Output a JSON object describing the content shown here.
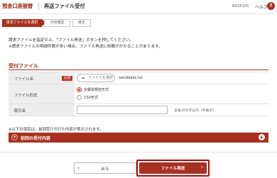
{
  "header": {
    "app_title": "預金口座振替",
    "page_title": "再送ファイル受付",
    "screen_id": "BKZF105",
    "help_label": "ヘルプ",
    "help_icon_glyph": "?"
  },
  "steps": [
    {
      "label": "請求ファイルを選択",
      "active": true
    },
    {
      "label": "内容確認",
      "active": false
    },
    {
      "label": "確定",
      "active": false
    }
  ],
  "instructions": [
    "請求ファイルを指定の上、「ファイル再送」ボタンを押してください。",
    "※請求ファイルの明細件数が多い場合、ファイル再送に時間がかかることがあります。"
  ],
  "section": {
    "title": "受付ファイル"
  },
  "form": {
    "file_label": "ファイル名",
    "required_badge": "必須",
    "file_button_label": "ファイルを選択",
    "file_name": "senddata.txt",
    "format_label": "ファイル形式",
    "format_options": [
      {
        "label": "全銀協規定形式",
        "selected": true
      },
      {
        "label": "CSV形式",
        "selected": false
      }
    ],
    "memo_label": "取引名",
    "memo_value": "",
    "memo_hint": "全角10文字以内［半角可］"
  },
  "note": "※以下の項目は、前回受け付けた内容が表示されます。",
  "accordion": {
    "label": "前回の受付内容"
  },
  "buttons": {
    "back_label": "戻る",
    "submit_label": "ファイル再送"
  },
  "colors": {
    "accent": "#a8301f",
    "highlight_outline": "#c00000"
  }
}
